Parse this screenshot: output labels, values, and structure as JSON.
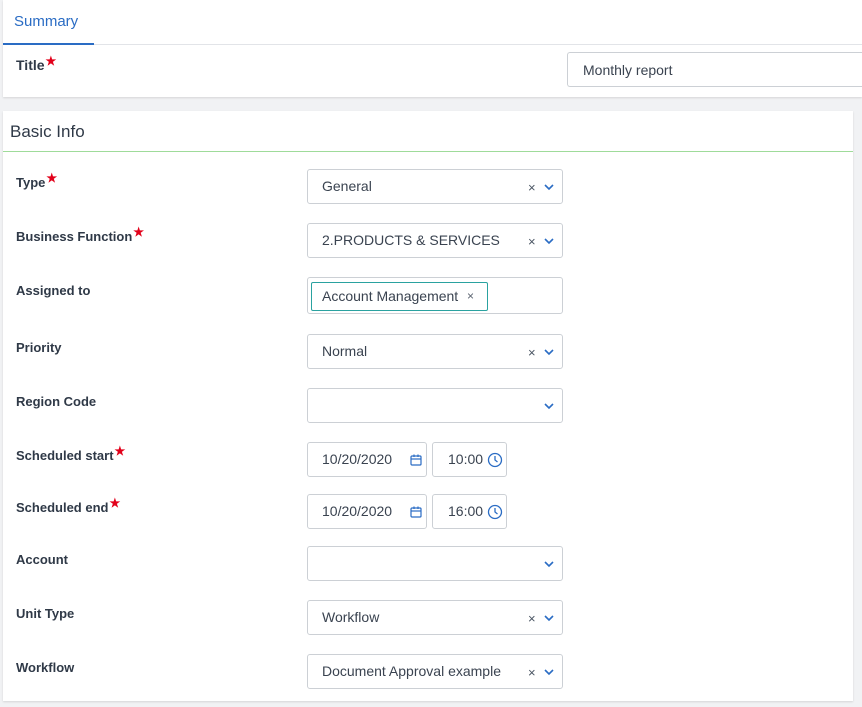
{
  "tabs": [
    {
      "label": "Summary"
    }
  ],
  "title_field": {
    "label": "Title",
    "value": "Monthly report"
  },
  "section": {
    "title": "Basic Info"
  },
  "fields": {
    "type": {
      "label": "Type",
      "value": "General"
    },
    "business_function": {
      "label": "Business Function",
      "value": "2.PRODUCTS & SERVICES"
    },
    "assigned_to": {
      "label": "Assigned to",
      "tag": "Account Management"
    },
    "priority": {
      "label": "Priority",
      "value": "Normal"
    },
    "region_code": {
      "label": "Region Code",
      "value": ""
    },
    "scheduled_start": {
      "label": "Scheduled start",
      "date": "10/20/2020",
      "time": "10:00"
    },
    "scheduled_end": {
      "label": "Scheduled end",
      "date": "10/20/2020",
      "time": "16:00"
    },
    "account": {
      "label": "Account",
      "value": ""
    },
    "unit_type": {
      "label": "Unit Type",
      "value": "Workflow"
    },
    "workflow": {
      "label": "Workflow",
      "value": "Document Approval example"
    }
  },
  "symbols": {
    "required": "★",
    "clear": "×"
  },
  "colors": {
    "accent": "#2a6cc4",
    "required": "#e2001a",
    "section_rule": "#9fdb9a",
    "tag_border": "#2aa2a0"
  }
}
